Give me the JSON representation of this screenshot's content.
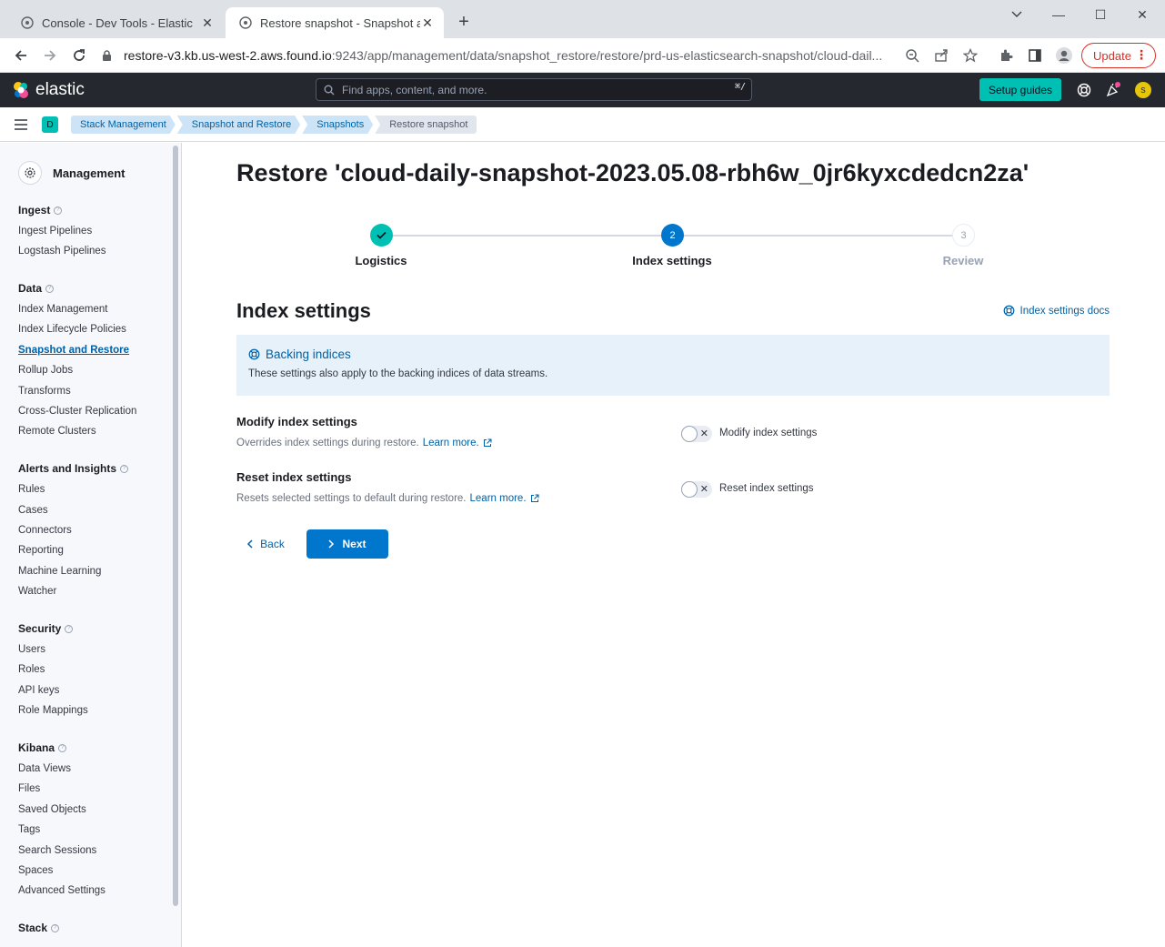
{
  "browser": {
    "tabs": [
      {
        "title": "Console - Dev Tools - Elastic",
        "close": "✕"
      },
      {
        "title": "Restore snapshot - Snapshot and",
        "close": "✕"
      }
    ],
    "new_tab": "+",
    "window_controls": {
      "minimize": "—",
      "maximize": "☐",
      "close": "✕"
    },
    "url_host": "restore-v3.kb.us-west-2.aws.found.io",
    "url_path": ":9243/app/management/data/snapshot_restore/restore/prd-us-elasticsearch-snapshot/cloud-dail...",
    "update_label": "Update",
    "update_menu": "⋮"
  },
  "header": {
    "brand": "elastic",
    "search_placeholder": "Find apps, content, and more.",
    "search_shortcut": "⌘/",
    "setup_guides": "Setup guides",
    "avatar_initial": "s"
  },
  "breadcrumbs": {
    "space_initial": "D",
    "items": [
      "Stack Management",
      "Snapshot and Restore",
      "Snapshots",
      "Restore snapshot"
    ]
  },
  "sidebar": {
    "title": "Management",
    "sections": [
      {
        "heading": "Ingest",
        "items": [
          "Ingest Pipelines",
          "Logstash Pipelines"
        ]
      },
      {
        "heading": "Data",
        "items": [
          "Index Management",
          "Index Lifecycle Policies",
          "Snapshot and Restore",
          "Rollup Jobs",
          "Transforms",
          "Cross-Cluster Replication",
          "Remote Clusters"
        ]
      },
      {
        "heading": "Alerts and Insights",
        "items": [
          "Rules",
          "Cases",
          "Connectors",
          "Reporting",
          "Machine Learning",
          "Watcher"
        ]
      },
      {
        "heading": "Security",
        "items": [
          "Users",
          "Roles",
          "API keys",
          "Role Mappings"
        ]
      },
      {
        "heading": "Kibana",
        "items": [
          "Data Views",
          "Files",
          "Saved Objects",
          "Tags",
          "Search Sessions",
          "Spaces",
          "Advanced Settings"
        ]
      },
      {
        "heading": "Stack",
        "items": []
      }
    ],
    "selected": "Snapshot and Restore"
  },
  "main": {
    "title": "Restore 'cloud-daily-snapshot-2023.05.08-rbh6w_0jr6kyxcdedcn2za'",
    "steps": [
      {
        "number": "1",
        "label": "Logistics",
        "status": "complete"
      },
      {
        "number": "2",
        "label": "Index settings",
        "status": "current"
      },
      {
        "number": "3",
        "label": "Review",
        "status": "incomplete"
      }
    ],
    "section_title": "Index settings",
    "docs_link": "Index settings docs",
    "callout": {
      "title": "Backing indices",
      "body": "These settings also apply to the backing indices of data streams."
    },
    "fields": [
      {
        "title": "Modify index settings",
        "description": "Overrides index settings during restore.",
        "learn_more": "Learn more.",
        "switch_label": "Modify index settings",
        "enabled": false
      },
      {
        "title": "Reset index settings",
        "description": "Resets selected settings to default during restore.",
        "learn_more": "Learn more.",
        "switch_label": "Reset index settings",
        "enabled": false
      }
    ],
    "back_label": "Back",
    "next_label": "Next"
  },
  "colors": {
    "primary": "#0077cc",
    "success": "#00bfb3",
    "header_bg": "#25282f",
    "link": "#0061a6"
  }
}
